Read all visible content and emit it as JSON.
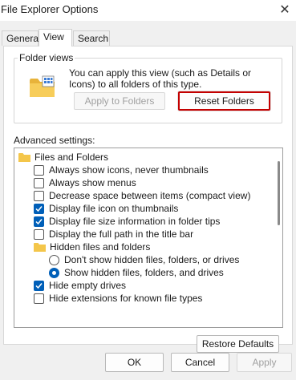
{
  "window": {
    "title": "File Explorer Options",
    "close_glyph": "✕"
  },
  "tabs": [
    {
      "label": "General",
      "active": false
    },
    {
      "label": "View",
      "active": true
    },
    {
      "label": "Search",
      "active": false
    }
  ],
  "folder_views": {
    "group_label": "Folder views",
    "icon": "folder-grid-icon",
    "description": "You can apply this view (such as Details or Icons) to all folders of this type.",
    "apply_label": "Apply to Folders",
    "reset_label": "Reset Folders"
  },
  "advanced": {
    "label": "Advanced settings:",
    "items": [
      {
        "type": "folder",
        "label": "Files and Folders"
      },
      {
        "type": "checkbox",
        "checked": false,
        "label": "Always show icons, never thumbnails"
      },
      {
        "type": "checkbox",
        "checked": false,
        "label": "Always show menus"
      },
      {
        "type": "checkbox",
        "checked": false,
        "label": "Decrease space between items (compact view)"
      },
      {
        "type": "checkbox",
        "checked": true,
        "label": "Display file icon on thumbnails"
      },
      {
        "type": "checkbox",
        "checked": true,
        "label": "Display file size information in folder tips"
      },
      {
        "type": "checkbox",
        "checked": false,
        "label": "Display the full path in the title bar"
      },
      {
        "type": "folder",
        "label": "Hidden files and folders"
      },
      {
        "type": "radio",
        "selected": false,
        "label": "Don't show hidden files, folders, or drives"
      },
      {
        "type": "radio",
        "selected": true,
        "label": "Show hidden files, folders, and drives"
      },
      {
        "type": "checkbox",
        "checked": true,
        "label": "Hide empty drives"
      },
      {
        "type": "checkbox",
        "checked": false,
        "label": "Hide extensions for known file types"
      }
    ]
  },
  "restore_defaults_label": "Restore Defaults",
  "footer": {
    "ok_label": "OK",
    "cancel_label": "Cancel",
    "apply_label": "Apply"
  },
  "colors": {
    "accent": "#005fb8",
    "highlight_border": "#c40000",
    "folder": "#f4c64a"
  }
}
